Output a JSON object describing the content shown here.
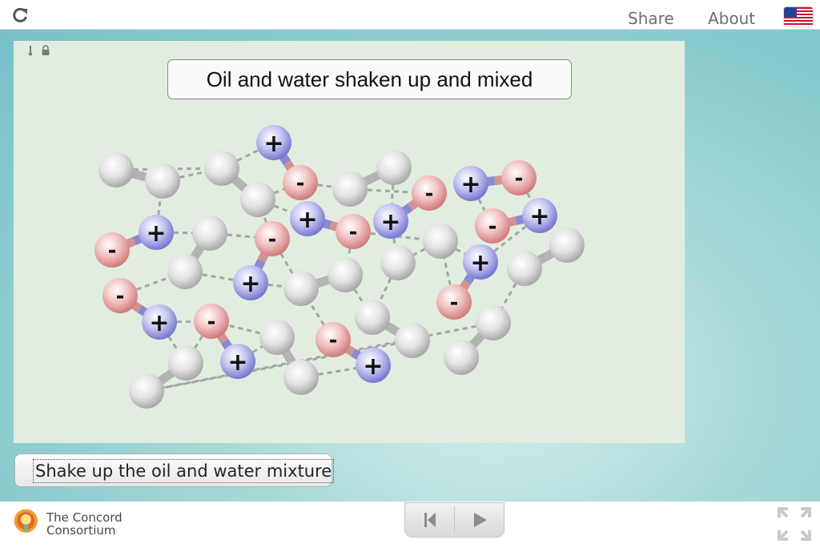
{
  "topbar": {
    "reload_icon": "reload-icon",
    "share_label": "Share",
    "about_label": "About",
    "language_flag": "us-flag-icon"
  },
  "model": {
    "title": "Oil and water shaken up and mixed",
    "toolbar_icons": [
      "thermometer-icon",
      "lock-icon"
    ],
    "colors": {
      "background": "#e1eedf",
      "neutral_atom": "#d9d9d9",
      "positive_atom": "#8e8ed8",
      "negative_atom": "#e49a9a"
    },
    "charge_labels": {
      "positive": "+",
      "negative": "-"
    }
  },
  "actions": {
    "shake_label": "Shake up the oil and water mixture"
  },
  "footer": {
    "logo_line1": "The Concord",
    "logo_line2": "Consortium",
    "controls": [
      "skip-back-icon",
      "play-icon"
    ],
    "fullscreen_icon": "fullscreen-icon"
  }
}
